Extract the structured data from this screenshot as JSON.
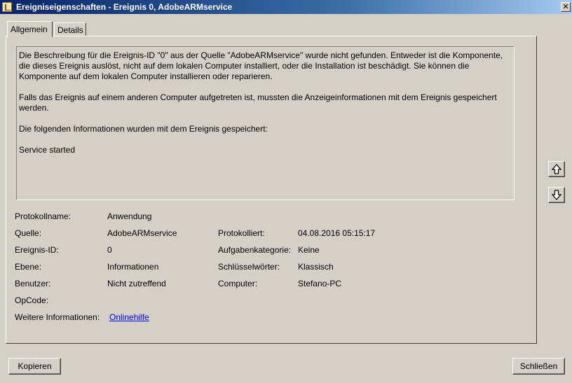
{
  "window": {
    "title": "Ereigniseigenschaften - Ereignis 0, AdobeARMservice"
  },
  "tabs": [
    {
      "label": "Allgemein"
    },
    {
      "label": "Details"
    }
  ],
  "description": {
    "p1": "Die Beschreibung für die Ereignis-ID \"0\" aus der Quelle \"AdobeARMservice\" wurde nicht gefunden. Entweder ist die Komponente, die dieses Ereignis auslöst, nicht auf dem lokalen Computer installiert, oder die Installation ist beschädigt. Sie können die Komponente auf dem lokalen Computer installieren oder reparieren.",
    "p2": "Falls das Ereignis auf einem anderen Computer aufgetreten ist, mussten die Anzeigeinformationen mit dem Ereignis gespeichert werden.",
    "p3": "Die folgenden Informationen wurden mit dem Ereignis gespeichert:",
    "p4": "Service started"
  },
  "fields": {
    "protokollname": {
      "label": "Protokollname:",
      "value": "Anwendung"
    },
    "quelle": {
      "label": "Quelle:",
      "value": "AdobeARMservice"
    },
    "ereignis_id": {
      "label": "Ereignis-ID:",
      "value": "0"
    },
    "ebene": {
      "label": "Ebene:",
      "value": "Informationen"
    },
    "benutzer": {
      "label": "Benutzer:",
      "value": "Nicht zutreffend"
    },
    "opcode": {
      "label": "OpCode:",
      "value": ""
    },
    "weitere": {
      "label": "Weitere Informationen:",
      "link": "Onlinehilfe"
    },
    "protokolliert": {
      "label": "Protokolliert:",
      "value": "04.08.2016 05:15:17"
    },
    "aufgabenkategorie": {
      "label": "Aufgabenkategorie:",
      "value": "Keine"
    },
    "schluesselwoerter": {
      "label": "Schlüsselwörter:",
      "value": "Klassisch"
    },
    "computer": {
      "label": "Computer:",
      "value": "Stefano-PC"
    }
  },
  "buttons": {
    "copy": "Kopieren",
    "close": "Schließen"
  },
  "icons": {
    "close": "close-icon",
    "up": "arrow-up-icon",
    "down": "arrow-down-icon"
  }
}
